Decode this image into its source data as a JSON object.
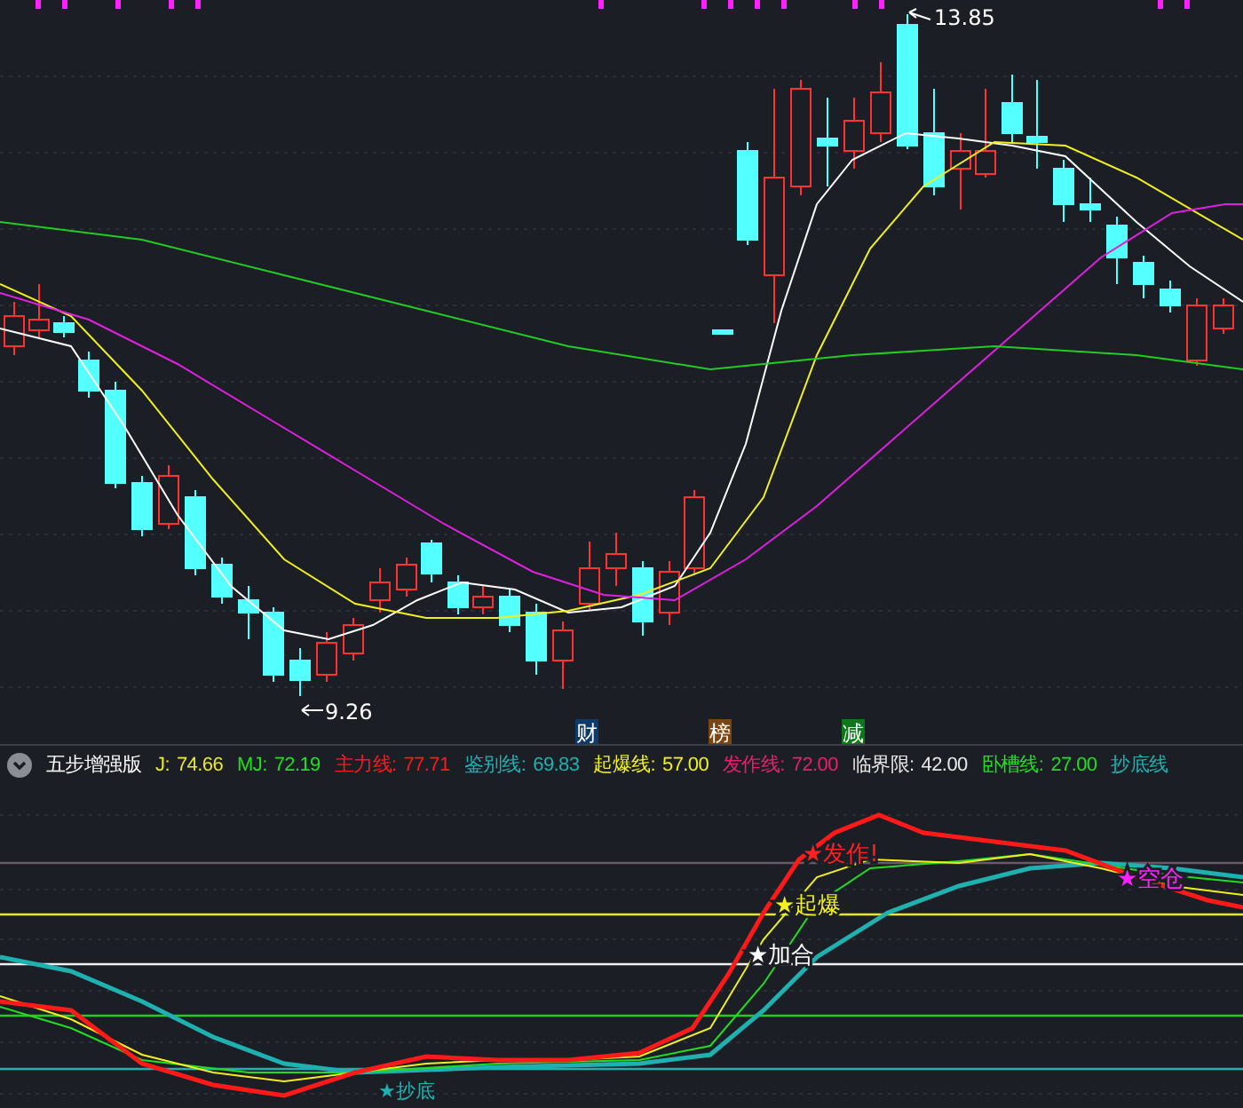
{
  "price_pane": {
    "high_label": "13.85",
    "low_label": "9.26"
  },
  "event_markers": [
    {
      "text": "财",
      "color": "#0d3a6b"
    },
    {
      "text": "榜",
      "color": "#7a4510"
    },
    {
      "text": "减",
      "color": "#0a7a18"
    }
  ],
  "indicator": {
    "name": "五步增强版",
    "lines": [
      {
        "label": "J:",
        "value": "74.66",
        "color": "#e8e830"
      },
      {
        "label": "MJ:",
        "value": "72.19",
        "color": "#22dd22"
      },
      {
        "label": "主力线:",
        "value": "77.71",
        "color": "#ff1a1a"
      },
      {
        "label": "鉴别线:",
        "value": "69.83",
        "color": "#1fb0b0"
      },
      {
        "label": "起爆线:",
        "value": "57.00",
        "color": "#f0f020"
      },
      {
        "label": "发作线:",
        "value": "72.00",
        "color": "#e8206a"
      },
      {
        "label": "临界限:",
        "value": "42.00",
        "color": "#e8e8e8"
      },
      {
        "label": "卧槽线:",
        "value": "27.00",
        "color": "#22dd22"
      },
      {
        "label": "抄底线",
        "color": "#1fb0b0"
      }
    ]
  },
  "signals": [
    {
      "text": "★发作!",
      "color": "#ff2020"
    },
    {
      "text": "★起爆",
      "color": "#f0f020"
    },
    {
      "text": "★加合",
      "color": "#ffffff"
    },
    {
      "text": "★空仓",
      "color": "#ff20ff"
    },
    {
      "text": "★抄底",
      "color": "#1fb0b0"
    }
  ]
}
